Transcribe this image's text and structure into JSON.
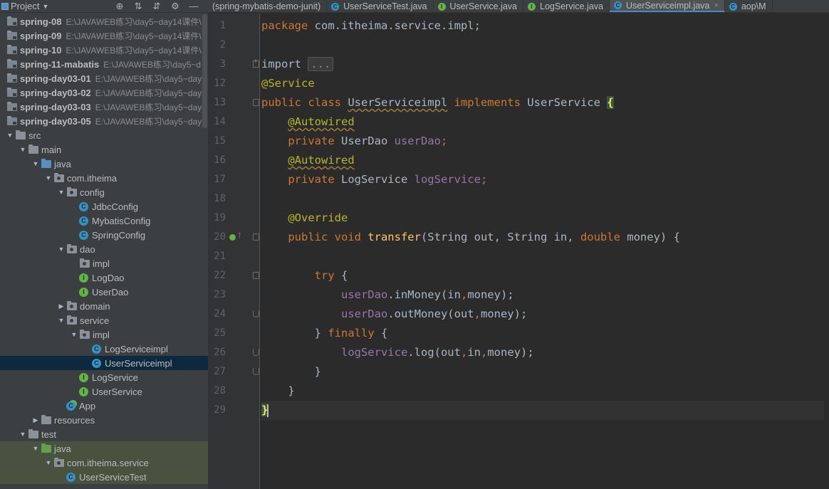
{
  "project_panel": {
    "title": "Project",
    "tree": [
      {
        "label": "spring-08",
        "path": "E:\\JAVAWEB练习\\day5~day14课件\\",
        "type": "module",
        "bold": true,
        "depth": 0,
        "arrow": "none"
      },
      {
        "label": "spring-09",
        "path": "E:\\JAVAWEB练习\\day5~day14课件\\",
        "type": "module",
        "bold": true,
        "depth": 0,
        "arrow": "none"
      },
      {
        "label": "spring-10",
        "path": "E:\\JAVAWEB练习\\day5~day14课件\\",
        "type": "module",
        "bold": true,
        "depth": 0,
        "arrow": "none"
      },
      {
        "label": "spring-11-mabatis",
        "path": "E:\\JAVAWEB练习\\day5~d",
        "type": "module",
        "bold": true,
        "depth": 0,
        "arrow": "none"
      },
      {
        "label": "spring-day03-01",
        "path": "E:\\JAVAWEB练习\\day5~day",
        "type": "module",
        "bold": true,
        "depth": 0,
        "arrow": "none"
      },
      {
        "label": "spring-day03-02",
        "path": "E:\\JAVAWEB练习\\day5~day",
        "type": "module",
        "bold": true,
        "depth": 0,
        "arrow": "none"
      },
      {
        "label": "spring-day03-03",
        "path": "E:\\JAVAWEB练习\\day5~day",
        "type": "module",
        "bold": true,
        "depth": 0,
        "arrow": "none"
      },
      {
        "label": "spring-day03-05",
        "path": "E:\\JAVAWEB练习\\day5~day",
        "type": "module",
        "bold": true,
        "depth": 0,
        "arrow": "none"
      },
      {
        "label": "src",
        "path": "",
        "type": "folder",
        "bold": false,
        "depth": 0,
        "arrow": "down"
      },
      {
        "label": "main",
        "path": "",
        "type": "folder",
        "bold": false,
        "depth": 1,
        "arrow": "down"
      },
      {
        "label": "java",
        "path": "",
        "type": "src",
        "bold": false,
        "depth": 2,
        "arrow": "down"
      },
      {
        "label": "com.itheima",
        "path": "",
        "type": "pkg",
        "bold": false,
        "depth": 3,
        "arrow": "down"
      },
      {
        "label": "config",
        "path": "",
        "type": "pkg",
        "bold": false,
        "depth": 4,
        "arrow": "down"
      },
      {
        "label": "JdbcConfig",
        "path": "",
        "type": "class",
        "bold": false,
        "depth": 5,
        "arrow": "none"
      },
      {
        "label": "MybatisConfig",
        "path": "",
        "type": "class",
        "bold": false,
        "depth": 5,
        "arrow": "none"
      },
      {
        "label": "SpringConfig",
        "path": "",
        "type": "class",
        "bold": false,
        "depth": 5,
        "arrow": "none"
      },
      {
        "label": "dao",
        "path": "",
        "type": "pkg",
        "bold": false,
        "depth": 4,
        "arrow": "down"
      },
      {
        "label": "impl",
        "path": "",
        "type": "pkg",
        "bold": false,
        "depth": 5,
        "arrow": "none"
      },
      {
        "label": "LogDao",
        "path": "",
        "type": "interface",
        "bold": false,
        "depth": 5,
        "arrow": "none"
      },
      {
        "label": "UserDao",
        "path": "",
        "type": "interface",
        "bold": false,
        "depth": 5,
        "arrow": "none"
      },
      {
        "label": "domain",
        "path": "",
        "type": "pkg",
        "bold": false,
        "depth": 4,
        "arrow": "right"
      },
      {
        "label": "service",
        "path": "",
        "type": "pkg",
        "bold": false,
        "depth": 4,
        "arrow": "down"
      },
      {
        "label": "impl",
        "path": "",
        "type": "pkg",
        "bold": false,
        "depth": 5,
        "arrow": "down"
      },
      {
        "label": "LogServiceimpl",
        "path": "",
        "type": "class",
        "bold": false,
        "depth": 6,
        "arrow": "none"
      },
      {
        "label": "UserServiceimpl",
        "path": "",
        "type": "class",
        "bold": false,
        "depth": 6,
        "arrow": "none",
        "selected": true
      },
      {
        "label": "LogService",
        "path": "",
        "type": "interface",
        "bold": false,
        "depth": 5,
        "arrow": "none"
      },
      {
        "label": "UserService",
        "path": "",
        "type": "interface",
        "bold": false,
        "depth": 5,
        "arrow": "none"
      },
      {
        "label": "App",
        "path": "",
        "type": "app",
        "bold": false,
        "depth": 4,
        "arrow": "none"
      },
      {
        "label": "resources",
        "path": "",
        "type": "res",
        "bold": false,
        "depth": 2,
        "arrow": "right"
      },
      {
        "label": "test",
        "path": "",
        "type": "folder",
        "bold": false,
        "depth": 1,
        "arrow": "down"
      },
      {
        "label": "java",
        "path": "",
        "type": "test-src",
        "bold": false,
        "depth": 2,
        "arrow": "down",
        "test": true
      },
      {
        "label": "com.itheima.service",
        "path": "",
        "type": "pkg",
        "bold": false,
        "depth": 3,
        "arrow": "down",
        "test": true
      },
      {
        "label": "UserServiceTest",
        "path": "",
        "type": "class",
        "bold": false,
        "depth": 4,
        "arrow": "none",
        "test": true
      }
    ]
  },
  "tabs": [
    {
      "label": "(spring-mybatis-demo-junit)",
      "icon": "none",
      "active": false
    },
    {
      "label": "UserServiceTest.java",
      "icon": "class",
      "active": false
    },
    {
      "label": "UserService.java",
      "icon": "interface",
      "active": false
    },
    {
      "label": "LogService.java",
      "icon": "interface",
      "active": false
    },
    {
      "label": "UserServiceimpl.java",
      "icon": "class",
      "active": true
    },
    {
      "label": "aop\\M",
      "icon": "class",
      "active": false
    }
  ],
  "editor": {
    "line_numbers": [
      "1",
      "2",
      "3",
      "12",
      "13",
      "14",
      "15",
      "16",
      "17",
      "18",
      "19",
      "20",
      "21",
      "22",
      "23",
      "24",
      "25",
      "26",
      "27",
      "28",
      "29"
    ],
    "line_package": [
      "package",
      " com.itheima.service.impl;"
    ],
    "line_import": [
      "import",
      " ",
      "..."
    ],
    "line_service": "@Service",
    "line_class": [
      "public class ",
      "UserServiceimpl",
      " implements ",
      "UserService ",
      "{"
    ],
    "line_autowired": "@Autowired",
    "line_userdao": [
      "private ",
      "UserDao ",
      "userDao",
      ";"
    ],
    "line_logservice": [
      "private ",
      "LogService ",
      "logService",
      ";"
    ],
    "line_override": "@Override",
    "line_transfer": [
      "public void ",
      "transfer",
      "(String out, String in, ",
      "double",
      " money) {"
    ],
    "line_try": [
      "try",
      " {"
    ],
    "line_inmoney": [
      "userDao",
      ".inMoney(in",
      ",",
      "money);"
    ],
    "line_outmoney": [
      "userDao",
      ".outMoney(out",
      ",",
      "money);"
    ],
    "line_finally": [
      "} ",
      "finally",
      " {"
    ],
    "line_log": [
      "logService",
      ".log(out",
      ",",
      "in",
      ",",
      "money);"
    ],
    "line_close_try": "}",
    "line_close_method": "}",
    "line_close_class": "}"
  },
  "colors": {
    "keyword": "#cc7832",
    "annotation": "#bbb529",
    "field": "#9876aa",
    "method": "#ffc66d",
    "active_tab_underline": "#4a88c7",
    "selected_row": "#0d293e"
  }
}
